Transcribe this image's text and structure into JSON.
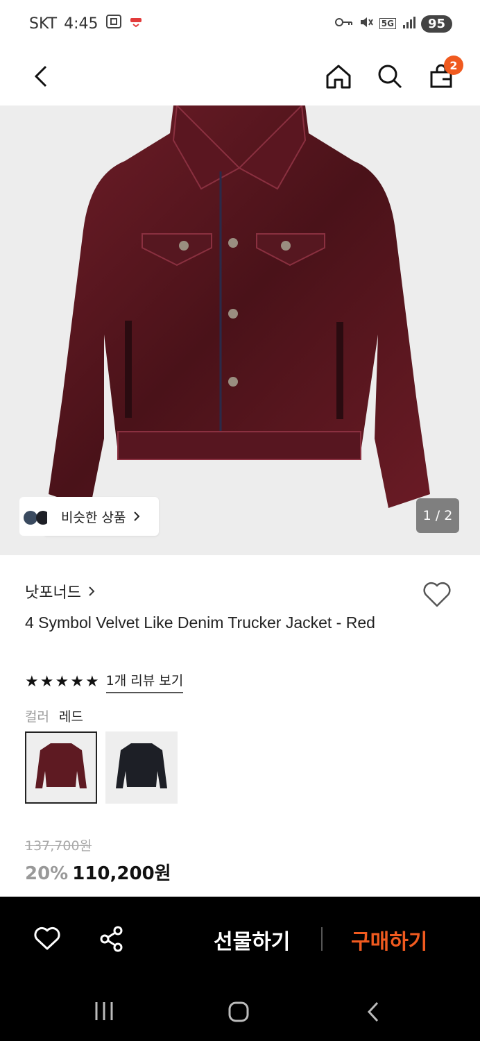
{
  "status": {
    "carrier": "SKT",
    "time": "4:45",
    "network": "5G",
    "battery": "95"
  },
  "header": {
    "cart_count": "2"
  },
  "gallery": {
    "similar_label": "비슷한 상품",
    "pager": "1 / 2"
  },
  "product": {
    "brand": "낫포너드",
    "name": "4 Symbol Velvet Like Denim Trucker Jacket - Red",
    "rating": 5,
    "review_link": "1개 리뷰 보기",
    "color_label": "컬러",
    "color_value": "레드",
    "swatches": [
      "red",
      "black"
    ],
    "original_price": "137,700원",
    "discount": "20%",
    "sale_price": "110,200원"
  },
  "actions": {
    "gift_label": "선물하기",
    "buy_label": "구매하기"
  },
  "colors": {
    "accent": "#f05a1f",
    "jacket_red": "#5e1a22",
    "jacket_black": "#1d1f26"
  }
}
